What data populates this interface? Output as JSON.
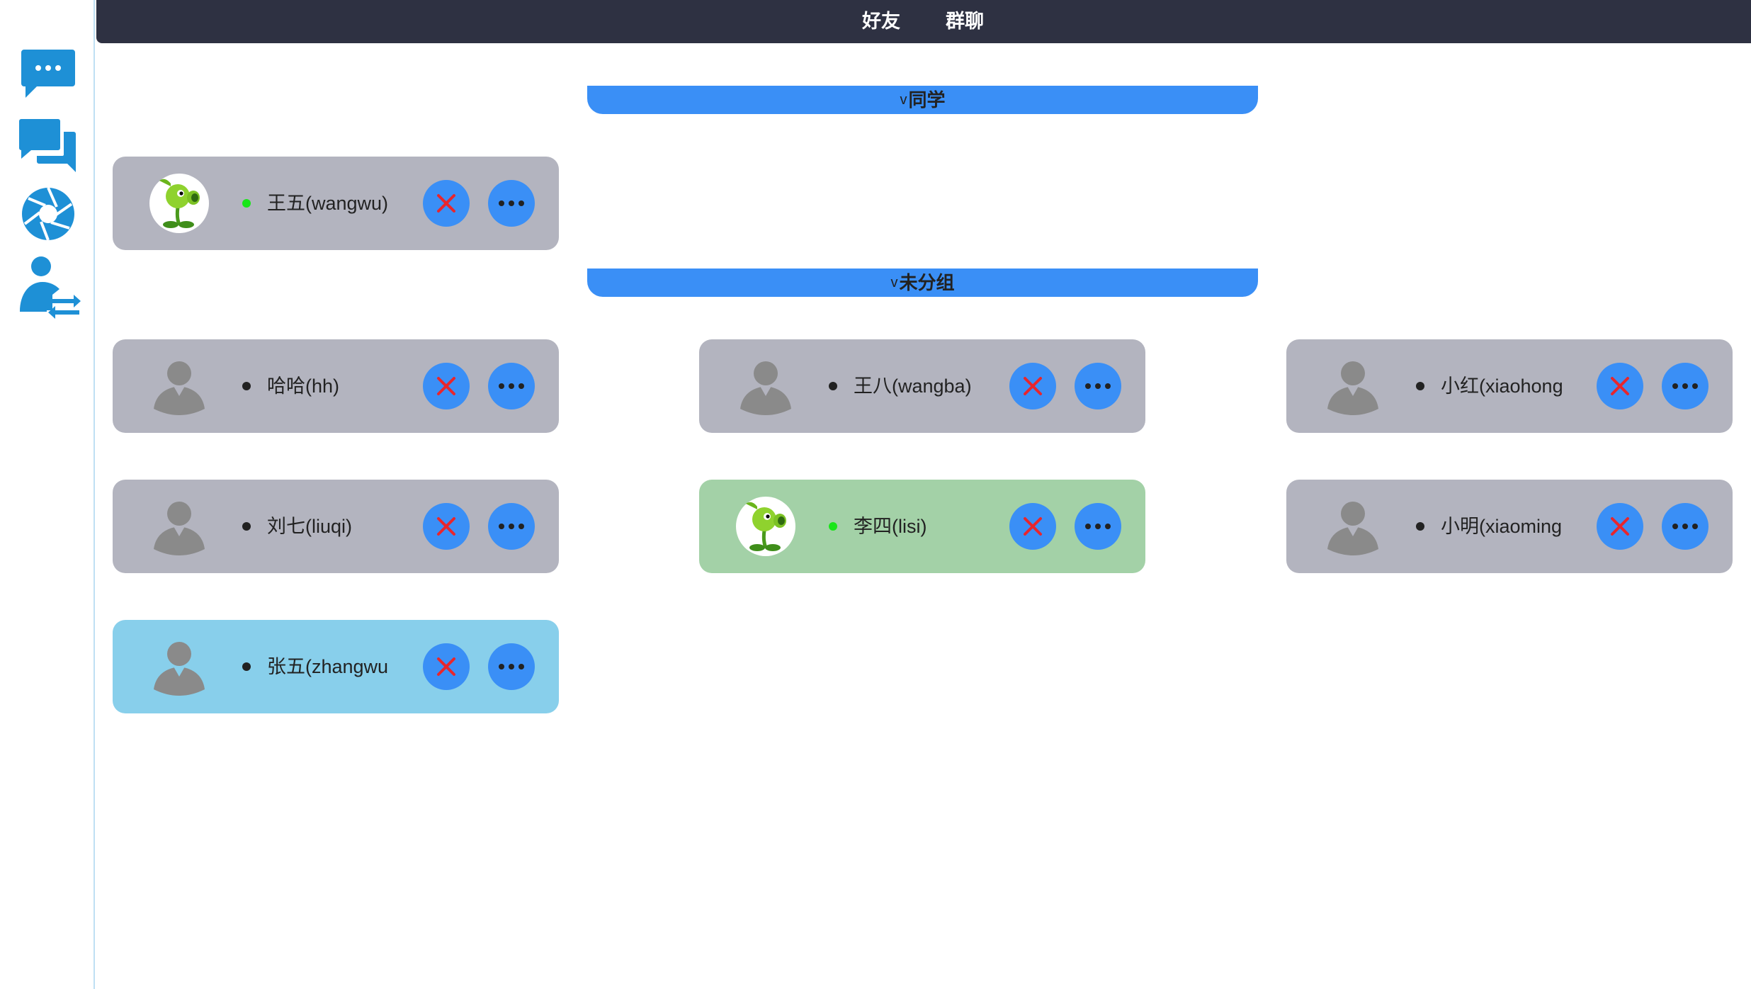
{
  "tabs": [
    {
      "label": "好友"
    },
    {
      "label": "群聊"
    }
  ],
  "sidebar": {
    "items": [
      {
        "icon": "chat-bubble-icon"
      },
      {
        "icon": "conversations-icon"
      },
      {
        "icon": "aperture-icon"
      },
      {
        "icon": "user-switch-icon"
      }
    ]
  },
  "groups": [
    {
      "chevron": "v",
      "name": "同学"
    },
    {
      "chevron": "v",
      "name": "未分组"
    }
  ],
  "friends": [
    {
      "name": "王五(wangwu)",
      "online": true,
      "avatar": "peashooter-avatar",
      "group": "同学"
    },
    {
      "name": "哈哈(hh)",
      "online": false,
      "avatar": "default-avatar",
      "group": "未分组"
    },
    {
      "name": "王八(wangba)",
      "online": false,
      "avatar": "default-avatar",
      "group": "未分组"
    },
    {
      "name": "小红(xiaohong",
      "online": false,
      "avatar": "default-avatar",
      "group": "未分组"
    },
    {
      "name": "刘七(liuqi)",
      "online": false,
      "avatar": "default-avatar",
      "group": "未分组"
    },
    {
      "name": "李四(lisi)",
      "online": true,
      "avatar": "peashooter-avatar",
      "group": "未分组",
      "highlight": "green"
    },
    {
      "name": "小明(xiaoming",
      "online": false,
      "avatar": "default-avatar",
      "group": "未分组"
    },
    {
      "name": "张五(zhangwu",
      "online": false,
      "avatar": "default-avatar",
      "group": "未分组",
      "highlight": "blue"
    }
  ],
  "colors": {
    "topbar": "#2e3142",
    "accent": "#3a8ff6",
    "card": "#b3b4bf",
    "card_green": "#a3d1a7",
    "card_blue": "#88cfeb",
    "online": "#19e619",
    "delete_x": "#e8262d",
    "sidebar_icon": "#1e90d6"
  }
}
